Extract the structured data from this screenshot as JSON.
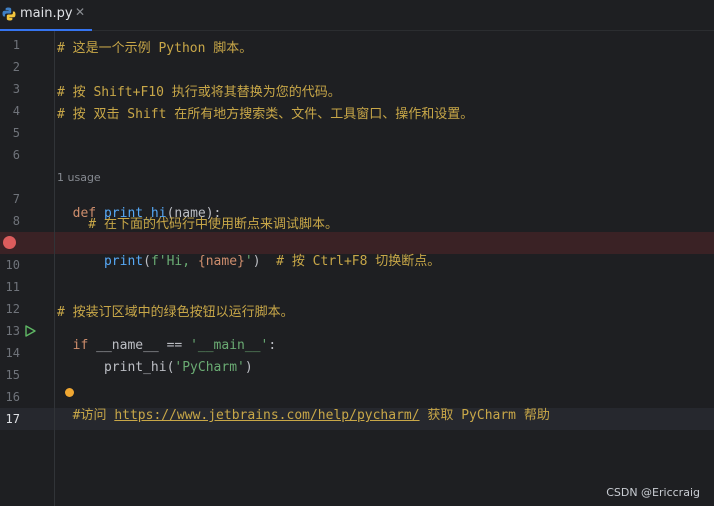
{
  "tab": {
    "filename": "main.py",
    "close_glyph": "✕"
  },
  "lines": {
    "n1": "1",
    "n2": "2",
    "n3": "3",
    "n4": "4",
    "n5": "5",
    "n6": "6",
    "n7": "7",
    "n8": "8",
    "n10": "10",
    "n11": "11",
    "n12": "12",
    "n13": "13",
    "n14": "14",
    "n15": "15",
    "n16": "16",
    "n17": "17"
  },
  "code": {
    "l1": "# 这是一个示例 Python 脚本。",
    "l3": "# 按 Shift+F10 执行或将其替换为您的代码。",
    "l4": "# 按 双击 Shift 在所有地方搜索类、文件、工具窗口、操作和设置。",
    "usage_hint": "1 usage",
    "l7_kw": "def",
    "l7_fn": "print_hi",
    "l7_rest": "(name):",
    "l8": "    # 在下面的代码行中使用断点来调试脚本。",
    "l9_fn": "    print",
    "l9_a": "(",
    "l9_str1": "f'Hi, ",
    "l9_b": "{name}",
    "l9_str2": "'",
    "l9_c": ")",
    "l9_comment": "  # 按 Ctrl+F8 切换断点。",
    "l12": "# 按装订区域中的绿色按钮以运行脚本。",
    "l13_kw": "if",
    "l13_a": " __name__ == ",
    "l13_str": "'__main__'",
    "l13_b": ":",
    "l14_a": "    print_hi(",
    "l14_str": "'PyCharm'",
    "l14_b": ")",
    "l16_hash": "#",
    "l16_visit": "访问 ",
    "l16_link": "https://www.jetbrains.com/help/pycharm/",
    "l16_rest": " 获取 PyCharm 帮助"
  },
  "watermark": "CSDN @Ericcraig",
  "colors": {
    "background": "#1e1f22",
    "comment": "#c8a748",
    "keyword": "#cf8e6d",
    "function": "#56a8f5",
    "string": "#6aab73",
    "breakpoint_row": "#3a2225",
    "breakpoint": "#db5c5c",
    "current_line": "#26282e"
  },
  "icons": {
    "file_icon": "python-file-icon",
    "breakpoint": "breakpoint-icon",
    "run": "run-gutter-icon",
    "intention": "lightbulb-icon"
  }
}
